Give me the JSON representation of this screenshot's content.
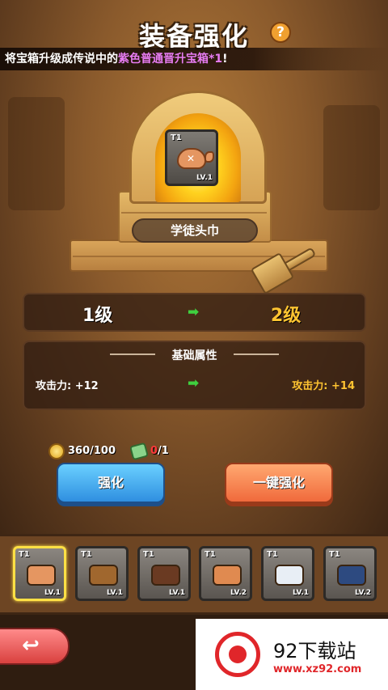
{
  "header": {
    "title": "装备强化",
    "help_label": "?",
    "notice_prefix": "将宝箱升级成传说中的",
    "notice_highlight": "紫色普通晋升宝箱*1",
    "notice_suffix": "!"
  },
  "forge": {
    "item": {
      "tier": "T1",
      "level": "LV.1",
      "icon": "bandana-icon"
    },
    "item_name": "学徒头巾"
  },
  "level_upgrade": {
    "from": "1级",
    "to": "2级"
  },
  "attributes": {
    "header": "基础属性",
    "old_value": "攻击力: +12",
    "new_value": "攻击力: +14"
  },
  "cost": {
    "gold": "360/100",
    "scroll_current": "0",
    "scroll_required": "/1"
  },
  "buttons": {
    "enhance": "强化",
    "one_click_enhance": "一键强化",
    "back_icon": "back-arrow-icon"
  },
  "inventory": [
    {
      "tier": "T1",
      "level": "LV.1",
      "icon": "bandana-icon",
      "color": "#e59661",
      "selected": true
    },
    {
      "tier": "T1",
      "level": "LV.1",
      "icon": "hook-hand-icon",
      "color": "#a0672e",
      "selected": false
    },
    {
      "tier": "T1",
      "level": "LV.1",
      "icon": "belt-icon",
      "color": "#6a3a22",
      "selected": false
    },
    {
      "tier": "T1",
      "level": "LV.2",
      "icon": "sandal-icon",
      "color": "#e08a50",
      "selected": false
    },
    {
      "tier": "T1",
      "level": "LV.1",
      "icon": "striped-shirt-icon",
      "color": "#e8eef5",
      "selected": false
    },
    {
      "tier": "T1",
      "level": "LV.2",
      "icon": "pants-icon",
      "color": "#2d4a80",
      "selected": false
    }
  ],
  "watermark": {
    "title": "92下载站",
    "url": "www.xz92.com"
  },
  "colors": {
    "accent_gold": "#ffc431",
    "notice_purple": "#e77cf2",
    "enhance_blue": "#2f8fe0",
    "one_click_orange": "#f06a3c",
    "cost_red": "#ff3a3a"
  }
}
